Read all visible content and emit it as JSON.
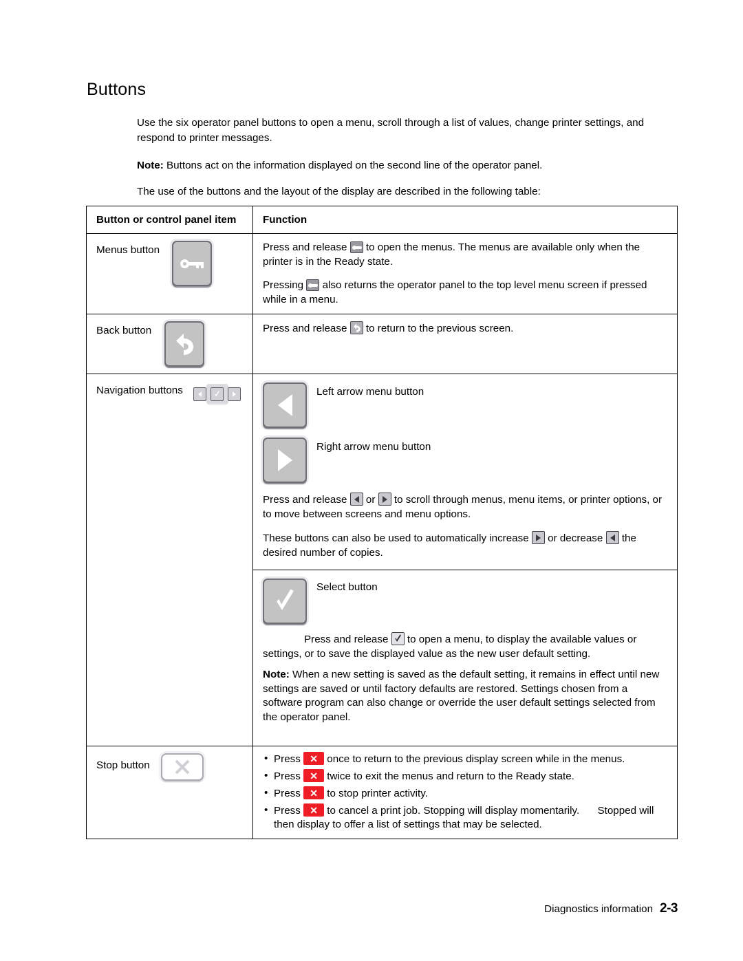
{
  "document": {
    "heading": "Buttons",
    "intro_paragraphs": [
      "Use the six operator panel buttons to open a menu, scroll through a list of values, change printer settings, and respond to printer messages."
    ],
    "note_label": "Note:",
    "note_text": "Buttons act on the information displayed on the second line of the operator panel.",
    "lead_in": "The use of the buttons and the layout of the display are described in the following table:"
  },
  "table": {
    "headers": {
      "col1": "Button or control panel item",
      "col2": "Function"
    },
    "rows": {
      "menus": {
        "label": "Menus button",
        "icon": "menus-key-button",
        "para1_a": "Press and release",
        "para1_b": "to open the menus. The menus are available only when the printer is in the Ready state.",
        "para2_a": "Pressing",
        "para2_b": "also returns the operator panel to the top level menu screen if pressed while in a menu."
      },
      "back": {
        "label": "Back button",
        "icon": "back-return-arrow-button",
        "para_a": "Press and release",
        "para_b": "to return to the previous screen."
      },
      "navigation": {
        "label": "Navigation buttons",
        "icon": "navigation-cluster",
        "left_arrow_label": "Left arrow menu button",
        "right_arrow_label": "Right arrow menu button",
        "scroll_a": "Press and release",
        "scroll_or": "or",
        "scroll_b": "to scroll through menus, menu items, or printer options, or to move between screens and menu options.",
        "copies_a": "These buttons can also be used to automatically increase",
        "copies_mid": "or decrease",
        "copies_b": "the desired number of copies.",
        "select_label": "Select button",
        "select_a": "Press and release",
        "select_b": "to open a menu, to display the available values or settings, or to save the displayed value as the new user default setting.",
        "select_note_label": "Note:",
        "select_note_text": "When a new setting is saved as the default setting, it remains in effect until new settings are saved or until factory defaults are restored. Settings chosen from a software program can also change or override the user default settings selected from the operator panel."
      },
      "stop": {
        "label": "Stop button",
        "icon": "stop-x-button",
        "bullets": [
          {
            "pre": "Press",
            "post": "once to return to the previous display screen while in the menus."
          },
          {
            "pre": "Press",
            "post": "twice to exit the menus and return to the Ready state."
          },
          {
            "pre": "Press",
            "post": "to stop printer activity."
          },
          {
            "pre": "Press",
            "post": "to cancel a print job. Stopping will display momentarily.",
            "emphasis": "Stopped",
            "tail": "will then display to offer a list of settings that may be selected."
          }
        ]
      }
    }
  },
  "footer": {
    "section": "Diagnostics information",
    "page_number": "2-3"
  },
  "colors": {
    "stop_red": "#ee1c25",
    "button_face": "#c3c3c3",
    "button_border": "#6e6e74",
    "text": "#000000"
  }
}
